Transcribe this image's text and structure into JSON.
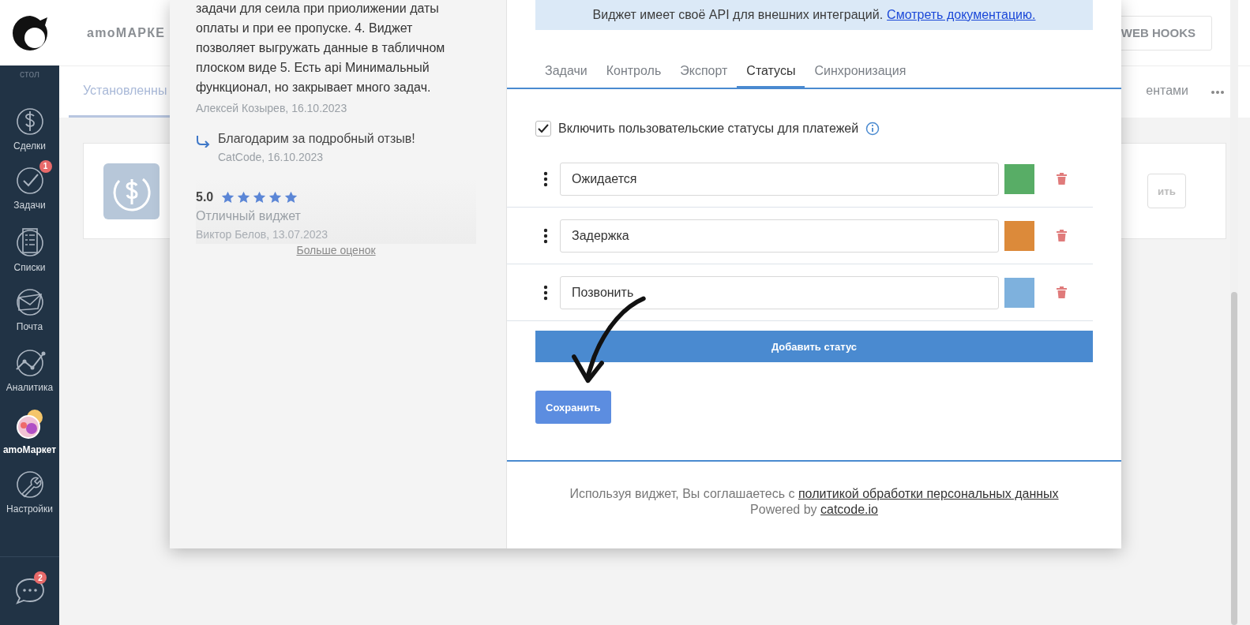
{
  "sidebar": {
    "top_caption": "стол",
    "items": [
      {
        "label": "Сделки",
        "selected": false
      },
      {
        "label": "Задачи",
        "selected": false,
        "badge": "1"
      },
      {
        "label": "Списки",
        "selected": false
      },
      {
        "label": "Почта",
        "selected": false
      },
      {
        "label": "Аналитика",
        "selected": false
      },
      {
        "label": "amoМаркет",
        "selected": true
      },
      {
        "label": "Настройки",
        "selected": false
      }
    ],
    "chat_badge": "2"
  },
  "header": {
    "title": "amoМАРКЕ",
    "button": "WEB HOOKS"
  },
  "page_tabs": [
    {
      "label": "Установленны",
      "selected": true
    },
    {
      "label": "ентами",
      "selected": false
    }
  ],
  "widget_card": {
    "button": "ить"
  },
  "modal": {
    "review": {
      "text": "задачи для сеила при приолижении даты оплаты и при ее пропуске. 4. Виджет позволяет выгружать данные в табличном плоском виде 5. Есть api Минимальный функционал, но закрывает много задач.",
      "author": "Алексей Козырев, 16.10.2023"
    },
    "reply": {
      "text": "Благодарим за подробный отзыв!",
      "author": "CatCode, 16.10.2023"
    },
    "review2": {
      "score": "5.0",
      "stars": 5,
      "title": "Отличный виджет",
      "author": "Виктор Белов, 13.07.2023"
    },
    "more_link": "Больше оценок",
    "api_notice": {
      "text": "Виджет имеет своё API для внешних интеграций.",
      "link": "Смотреть документацию."
    },
    "tabs": [
      {
        "label": "Задачи",
        "selected": false
      },
      {
        "label": "Контроль",
        "selected": false
      },
      {
        "label": "Экспорт",
        "selected": false
      },
      {
        "label": "Статусы",
        "selected": true
      },
      {
        "label": "Синхронизация",
        "selected": false
      }
    ],
    "custom_statuses": {
      "label": "Включить пользовательские статусы для платежей",
      "checked": true
    },
    "statuses": [
      {
        "value": "Ожидается",
        "color": "#58ad66"
      },
      {
        "value": "Задержка",
        "color": "#dc8a3a"
      },
      {
        "value": "Позвонить",
        "color": "#7eb1dd"
      }
    ],
    "add_button": "Добавить статус",
    "save_button": "Сохранить",
    "footer": {
      "text": "Используя виджет, Вы соглашаетесь с",
      "link": "политикой обработки персональных данных",
      "powered": "Powered by",
      "powered_link": "catcode.io"
    }
  }
}
